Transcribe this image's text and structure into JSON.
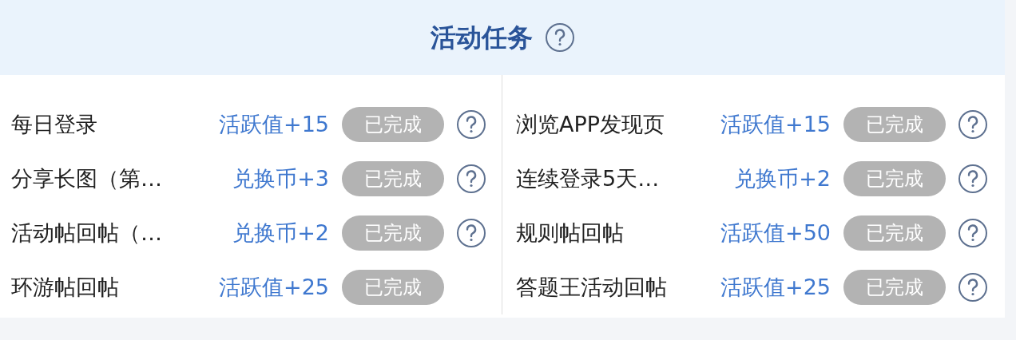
{
  "header": {
    "title": "活动任务",
    "has_help": true
  },
  "columns": [
    {
      "tasks": [
        {
          "name": "每日登录",
          "reward": "活跃值+15",
          "status": "已完成",
          "done": true,
          "has_help": true
        },
        {
          "name": "分享长图（第…",
          "reward": "兑换币+3",
          "status": "已完成",
          "done": true,
          "has_help": true
        },
        {
          "name": "活动帖回帖（…",
          "reward": "兑换币+2",
          "status": "已完成",
          "done": true,
          "has_help": true
        },
        {
          "name": "环游帖回帖",
          "reward": "活跃值+25",
          "status": "已完成",
          "done": true,
          "has_help": false
        }
      ]
    },
    {
      "tasks": [
        {
          "name": "浏览APP发现页",
          "reward": "活跃值+15",
          "status": "已完成",
          "done": true,
          "has_help": true
        },
        {
          "name": "连续登录5天…",
          "reward": "兑换币+2",
          "status": "已完成",
          "done": true,
          "has_help": true
        },
        {
          "name": "规则帖回帖",
          "reward": "活跃值+50",
          "status": "已完成",
          "done": true,
          "has_help": true
        },
        {
          "name": "答题王活动回帖",
          "reward": "活跃值+25",
          "status": "已完成",
          "done": true,
          "has_help": true
        }
      ]
    }
  ]
}
